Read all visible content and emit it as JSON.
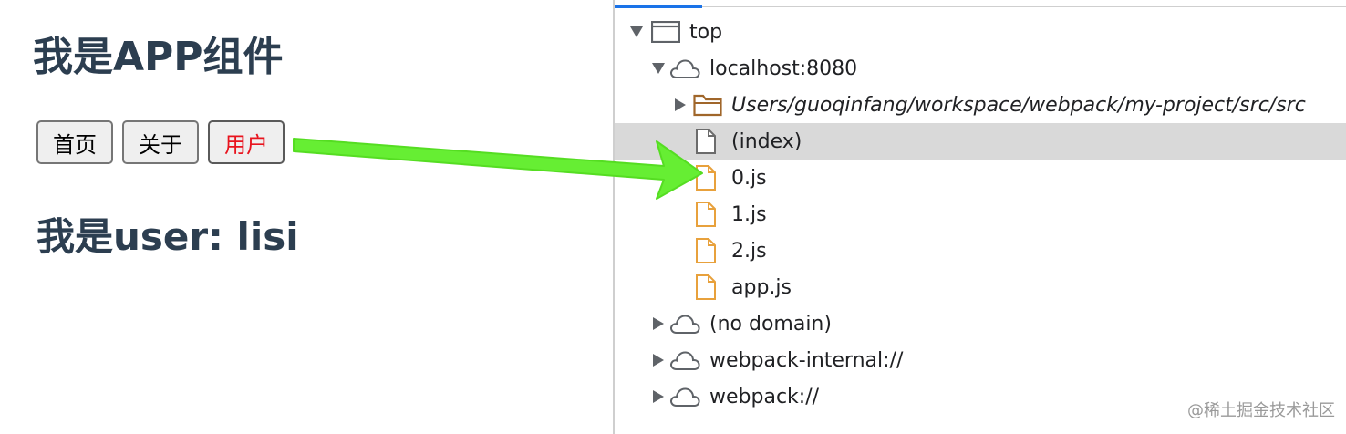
{
  "app": {
    "title": "我是APP组件",
    "nav": [
      {
        "label": "首页",
        "active": false
      },
      {
        "label": "关于",
        "active": false
      },
      {
        "label": "用户",
        "active": true
      }
    ],
    "user_line": "我是user: lisi"
  },
  "sources_tree": {
    "items": [
      {
        "label": "top",
        "icon": "frame-icon",
        "expanded": true
      },
      {
        "label": "localhost:8080",
        "icon": "cloud-icon",
        "expanded": true
      },
      {
        "label": "Users/guoqinfang/workspace/webpack/my-project/src/src",
        "icon": "folder-icon",
        "expanded": false
      },
      {
        "label": "(index)",
        "icon": "file-icon",
        "selected": true
      },
      {
        "label": "0.js",
        "icon": "js-file-icon"
      },
      {
        "label": "1.js",
        "icon": "js-file-icon"
      },
      {
        "label": "2.js",
        "icon": "js-file-icon"
      },
      {
        "label": "app.js",
        "icon": "js-file-icon"
      },
      {
        "label": "(no domain)",
        "icon": "cloud-icon",
        "expanded": false
      },
      {
        "label": "webpack-internal://",
        "icon": "cloud-icon",
        "expanded": false
      },
      {
        "label": "webpack://",
        "icon": "cloud-icon",
        "expanded": false
      }
    ]
  },
  "annotation": {
    "arrow_color": "#66ee33"
  },
  "colors": {
    "heading": "#2c3e50",
    "active_link": "#e8141e",
    "js_file": "#e8a13c",
    "folder": "#a0662a",
    "selected_row": "#d9d9d9"
  },
  "watermark": "@稀土掘金技术社区"
}
